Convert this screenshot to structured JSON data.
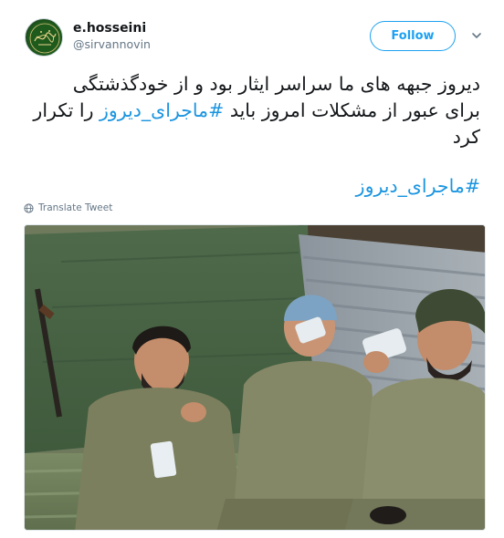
{
  "tweet": {
    "display_name": "e.hosseini",
    "handle": "@sirvannovin",
    "follow_label": "Follow",
    "text_line1": "دیروز جبهه های ما سراسر ایثار بود و از خودگذشتگی",
    "text_line2_before": "برای عبور از مشکلات امروز باید ",
    "text_line2_hashtag": "#ماجرای_دیروز",
    "text_line2_after": " را تکرار",
    "text_line3": "کرد",
    "hashtag": "#ماجرای_دیروز",
    "translate_label": "Translate Tweet",
    "photo_alt": "photo"
  },
  "icons": {
    "avatar": "avatar-calligraphy",
    "more": "chevron-down-icon",
    "translate": "globe-icon"
  },
  "colors": {
    "accent": "#1da1f2",
    "link": "#1b95e0",
    "muted": "#657786",
    "text": "#14171a"
  }
}
